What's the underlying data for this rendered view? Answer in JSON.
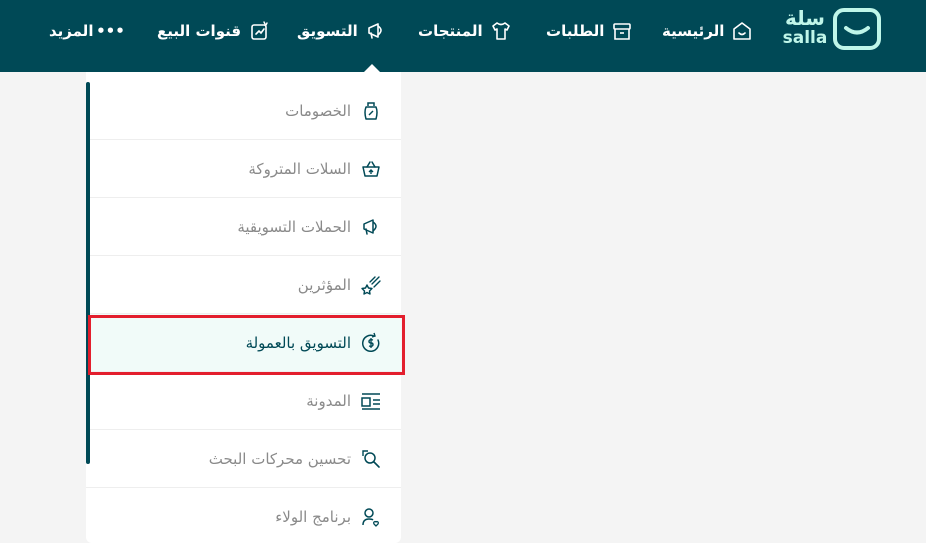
{
  "logo": {
    "arabic": "سلة",
    "latin": "salla"
  },
  "nav": {
    "home": "الرئيسية",
    "orders": "الطلبات",
    "products": "المنتجات",
    "marketing": "التسويق",
    "sales_channels": "قنوات البيع",
    "more": "المزيد",
    "more_icon": "•••"
  },
  "menu": {
    "items": [
      {
        "label": "الخصومات",
        "icon": "discount-bag-icon"
      },
      {
        "label": "السلات المتروكة",
        "icon": "abandoned-basket-icon"
      },
      {
        "label": "الحملات التسويقية",
        "icon": "megaphone-icon"
      },
      {
        "label": "المؤثرين",
        "icon": "shooting-star-icon"
      },
      {
        "label": "التسويق بالعمولة",
        "icon": "dollar-refresh-icon"
      },
      {
        "label": "المدونة",
        "icon": "blog-icon"
      },
      {
        "label": "تحسين محركات البحث",
        "icon": "seo-search-icon"
      },
      {
        "label": "برنامج الولاء",
        "icon": "loyalty-user-icon"
      }
    ],
    "active_index": 4
  },
  "colors": {
    "brand": "#004956",
    "logo_mint": "#bff6e9",
    "highlight": "#e31e2d"
  }
}
